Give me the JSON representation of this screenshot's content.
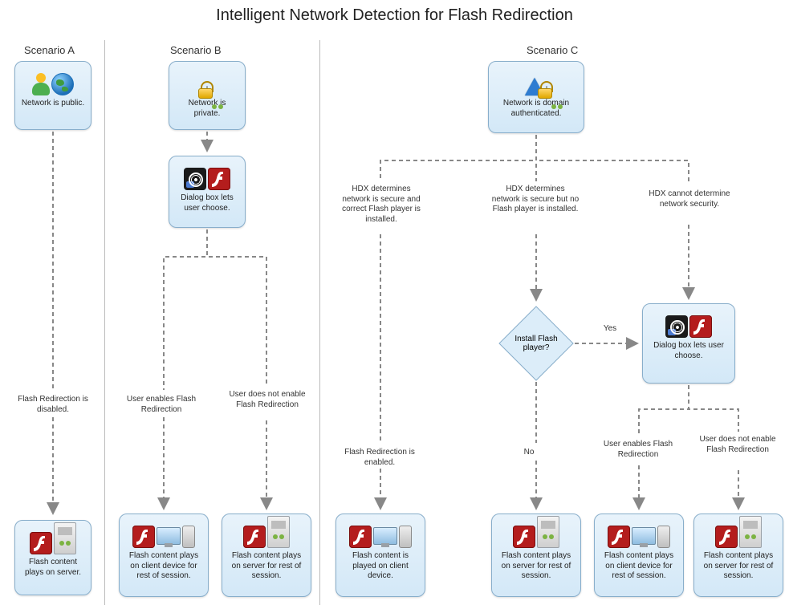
{
  "title": "Intelligent Network Detection for Flash Redirection",
  "scenarios": {
    "a": "Scenario A",
    "b": "Scenario B",
    "c": "Scenario C"
  },
  "nodes": {
    "a_start": "Network is public.",
    "a_end": "Flash content plays on server.",
    "b_start": "Network is private.",
    "b_dialog": "Dialog box lets user choose.",
    "b_client": "Flash content plays on client device for rest of session.",
    "b_server": "Flash content plays on server for rest of session.",
    "c_start": "Network is domain authenticated.",
    "c_dialog": "Dialog box lets user choose.",
    "c_client": "Flash content is played on client device.",
    "c_server1": "Flash content plays on server for rest of session.",
    "c_client2": "Flash content plays on client device for rest of session.",
    "c_server2": "Flash content plays on server for rest of session.",
    "c_decision": "Install Flash player?"
  },
  "edges": {
    "a_disabled": "Flash Redirection is disabled.",
    "b_enable": "User enables Flash Redirection",
    "b_noenable": "User does not enable Flash Redirection",
    "c_path1": "HDX determines network is secure and correct Flash player is installed.",
    "c_path2": "HDX determines network is secure but no Flash player is installed.",
    "c_path3": "HDX cannot determine network security.",
    "c_enabled": "Flash Redirection is enabled.",
    "c_yes": "Yes",
    "c_no": "No",
    "c_enable": "User enables Flash Redirection",
    "c_noenable": "User does not enable Flash Redirection"
  }
}
